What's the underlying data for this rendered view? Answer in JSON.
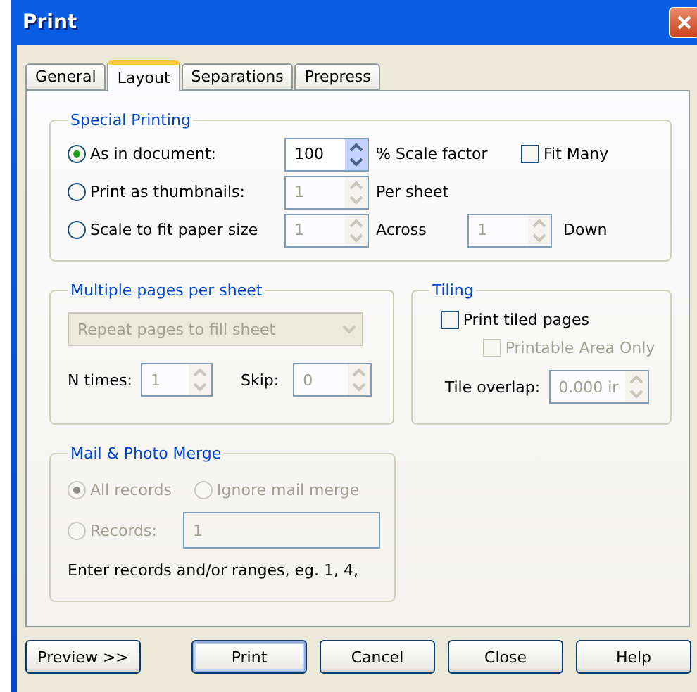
{
  "window": {
    "title": "Print"
  },
  "tabs": [
    {
      "label": "General",
      "selected": false
    },
    {
      "label": "Layout",
      "selected": true
    },
    {
      "label": "Separations",
      "selected": false
    },
    {
      "label": "Prepress",
      "selected": false
    }
  ],
  "special_printing": {
    "title": "Special Printing",
    "rows": [
      {
        "label": "As in document:",
        "selected": true,
        "spin": {
          "value": "100",
          "disabled": false
        },
        "unit": "% Scale factor",
        "checkbox": {
          "label": "Fit Many",
          "checked": false
        }
      },
      {
        "label": "Print as thumbnails:",
        "selected": false,
        "spin": {
          "value": "1",
          "disabled": true
        },
        "unit": "Per sheet"
      },
      {
        "label": "Scale to fit paper size",
        "selected": false,
        "spin": {
          "value": "1",
          "disabled": true
        },
        "unit": "Across",
        "spin2": {
          "value": "1",
          "disabled": true
        },
        "unit2": "Down"
      }
    ]
  },
  "multiple_pages": {
    "title": "Multiple pages per sheet",
    "dropdown": {
      "value": "Repeat pages to fill sheet",
      "disabled": true
    },
    "n_times": {
      "label": "N times:",
      "value": "1",
      "disabled": true
    },
    "skip": {
      "label": "Skip:",
      "value": "0",
      "disabled": true
    }
  },
  "tiling": {
    "title": "Tiling",
    "print_tiled": {
      "label": "Print tiled pages",
      "checked": false,
      "disabled": false
    },
    "printable_area": {
      "label": "Printable Area Only",
      "checked": false,
      "disabled": true
    },
    "tile_overlap": {
      "label": "Tile overlap:",
      "value": "0.000 ir",
      "disabled": true
    }
  },
  "mail_merge": {
    "title": "Mail & Photo Merge",
    "disabled": true,
    "options": [
      {
        "label": "All records",
        "selected": true
      },
      {
        "label": "Ignore mail merge",
        "selected": false
      }
    ],
    "records": {
      "label": "Records:",
      "selected": false,
      "value": "1"
    },
    "hint": "Enter records and/or ranges, eg. 1, 4,"
  },
  "buttons": [
    {
      "label": "Preview >>",
      "default": false
    },
    {
      "label": "Print",
      "default": true
    },
    {
      "label": "Cancel",
      "default": false
    },
    {
      "label": "Close",
      "default": false
    },
    {
      "label": "Help",
      "default": false
    }
  ]
}
